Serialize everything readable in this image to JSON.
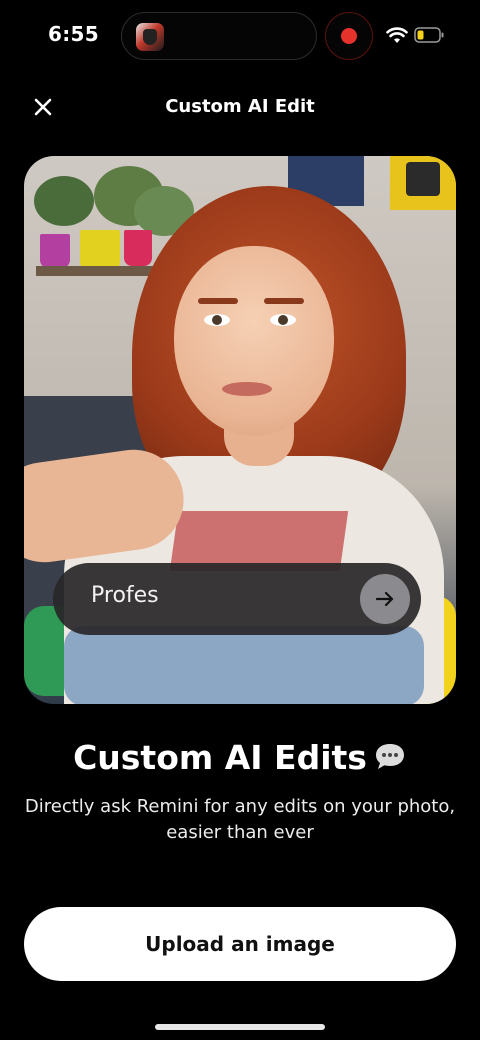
{
  "status_bar": {
    "time": "6:55",
    "recording_color": "#e5322a",
    "icons": [
      "app-thumbnail-icon",
      "record-icon",
      "wifi-icon",
      "battery-low-icon"
    ]
  },
  "header": {
    "title": "Custom AI Edit",
    "close_icon": "close-icon"
  },
  "hero": {
    "prompt_text": "Profes",
    "send_icon": "arrow-right-icon"
  },
  "content": {
    "headline": "Custom AI Edits",
    "headline_icon": "speech-bubble-icon",
    "description": "Directly ask Remini for any edits on your photo, easier than ever"
  },
  "actions": {
    "upload_label": "Upload an image"
  }
}
